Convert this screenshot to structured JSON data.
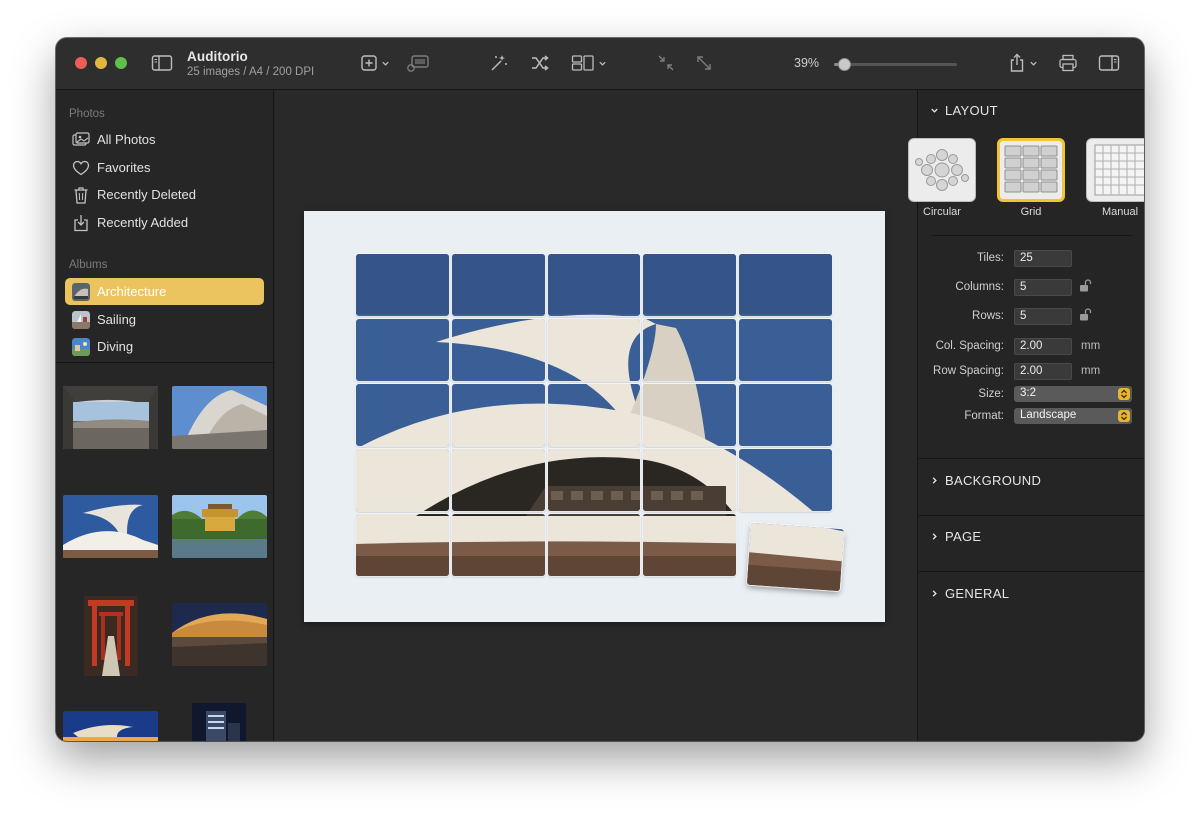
{
  "window": {
    "title": "Auditorio",
    "subtitle": "25 images / A4 / 200 DPI"
  },
  "toolbar": {
    "icons": [
      "sidebar-toggle-icon",
      "add-icon",
      "insert-photo-icon",
      "magic-wand-icon",
      "shuffle-icon",
      "layout-icon",
      "collapse-icon",
      "expand-icon",
      "share-icon",
      "print-icon",
      "inspector-toggle-icon"
    ],
    "zoom_label": "39%",
    "zoom_level": 0.08
  },
  "sidebar": {
    "photos_header": "Photos",
    "photos_items": [
      {
        "label": "All Photos",
        "icon": "photos-icon"
      },
      {
        "label": "Favorites",
        "icon": "heart-icon"
      },
      {
        "label": "Recently Deleted",
        "icon": "trash-icon"
      },
      {
        "label": "Recently Added",
        "icon": "download-tray-icon"
      }
    ],
    "albums_header": "Albums",
    "albums": [
      {
        "label": "Architecture",
        "selected": true
      },
      {
        "label": "Sailing",
        "selected": false
      },
      {
        "label": "Diving",
        "selected": false
      }
    ]
  },
  "mosaic": {
    "tiles": 25,
    "columns": 5,
    "rows": 5
  },
  "inspector": {
    "layout_header": "LAYOUT",
    "layout_options": [
      {
        "label": "Circular",
        "selected": false
      },
      {
        "label": "Grid",
        "selected": true
      },
      {
        "label": "Manual",
        "selected": false
      }
    ],
    "tiles_label": "Tiles:",
    "tiles_value": "25",
    "columns_label": "Columns:",
    "columns_value": "5",
    "rows_label": "Rows:",
    "rows_value": "5",
    "col_spacing_label": "Col. Spacing:",
    "col_spacing_value": "2.00",
    "row_spacing_label": "Row Spacing:",
    "row_spacing_value": "2.00",
    "unit": "mm",
    "size_label": "Size:",
    "size_value": "3:2",
    "format_label": "Format:",
    "format_value": "Landscape",
    "background_header": "BACKGROUND",
    "page_header": "PAGE",
    "general_header": "GENERAL"
  },
  "colors": {
    "accent": "#ecc45f",
    "selection_border": "#f0c435",
    "sky": "#3a5f96",
    "structure": "#ece6da"
  }
}
